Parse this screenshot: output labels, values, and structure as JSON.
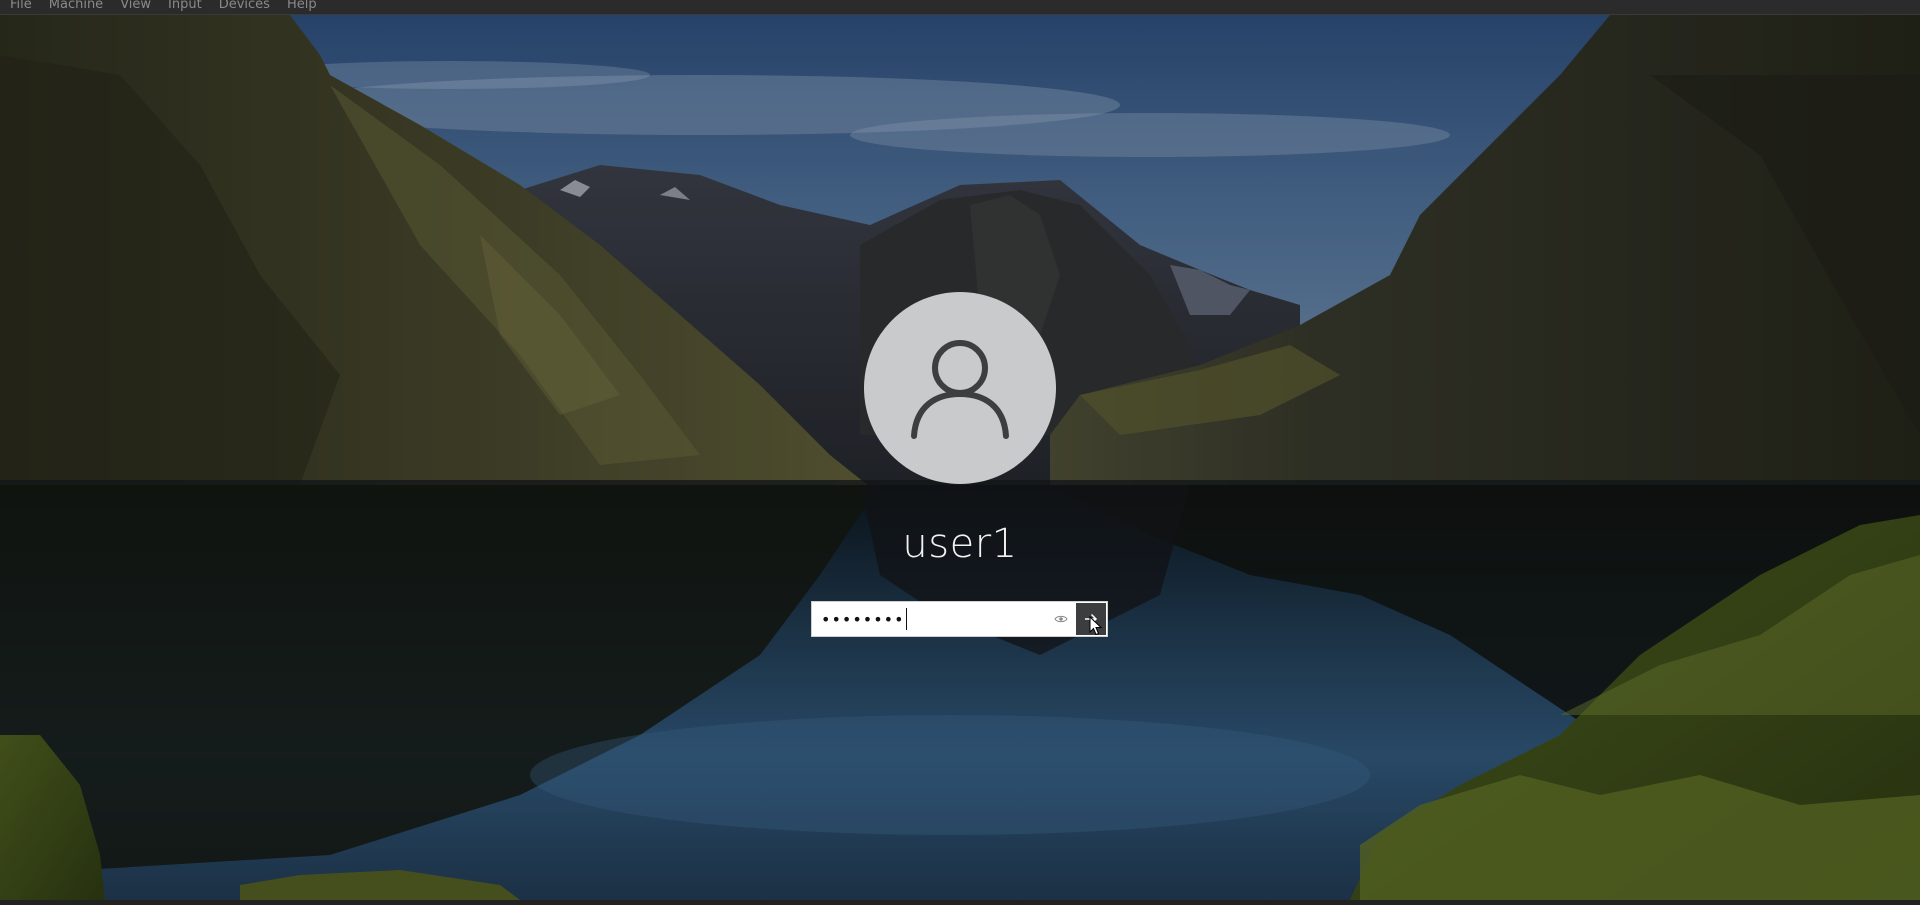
{
  "menubar": {
    "items": [
      "File",
      "Machine",
      "View",
      "Input",
      "Devices",
      "Help"
    ]
  },
  "login": {
    "username": "user1",
    "password_masked": "••••••••"
  },
  "icons": {
    "avatar": "user-silhouette-icon",
    "reveal": "eye-icon",
    "submit": "arrow-right-icon",
    "pointer": "mouse-pointer-icon"
  },
  "colors": {
    "avatar_bg": "#c9cacb",
    "avatar_glyph": "#3d3e40",
    "submit_bg": "#3c3d3f",
    "menubar_bg": "#2b2b2b",
    "text": "#f2f2f2"
  }
}
